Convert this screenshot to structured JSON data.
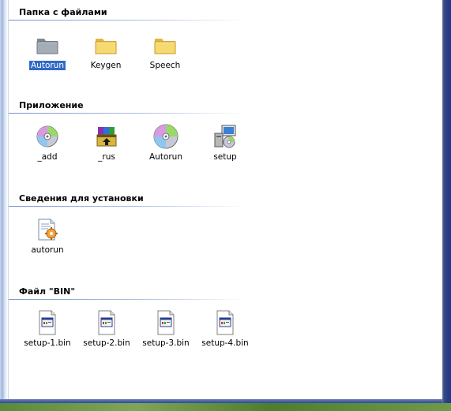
{
  "groups": [
    {
      "title": "Папка с файлами",
      "items": [
        {
          "label": "Autorun",
          "icon": "grey-folder-icon",
          "selected": true
        },
        {
          "label": "Keygen",
          "icon": "folder-icon"
        },
        {
          "label": "Speech",
          "icon": "folder-icon"
        }
      ]
    },
    {
      "title": "Приложение",
      "items": [
        {
          "label": "_add",
          "icon": "cd-disc-icon"
        },
        {
          "label": "_rus",
          "icon": "winrar-books-icon"
        },
        {
          "label": "Autorun",
          "icon": "cd-disc-icon"
        },
        {
          "label": "setup",
          "icon": "setup-computer-icon"
        }
      ]
    },
    {
      "title": "Сведения для установки",
      "items": [
        {
          "label": "autorun",
          "icon": "setup-information-icon"
        }
      ]
    },
    {
      "title": "Файл \"BIN\"",
      "items": [
        {
          "label": "setup-1.bin",
          "icon": "bin-file-icon"
        },
        {
          "label": "setup-2.bin",
          "icon": "bin-file-icon"
        },
        {
          "label": "setup-3.bin",
          "icon": "bin-file-icon"
        },
        {
          "label": "setup-4.bin",
          "icon": "bin-file-icon"
        }
      ]
    }
  ],
  "colors": {
    "selection": "#316ac5",
    "group_line": "#7593cf",
    "folder_yellow": "#f5d66b",
    "folder_grey": "#9aa3ab"
  }
}
